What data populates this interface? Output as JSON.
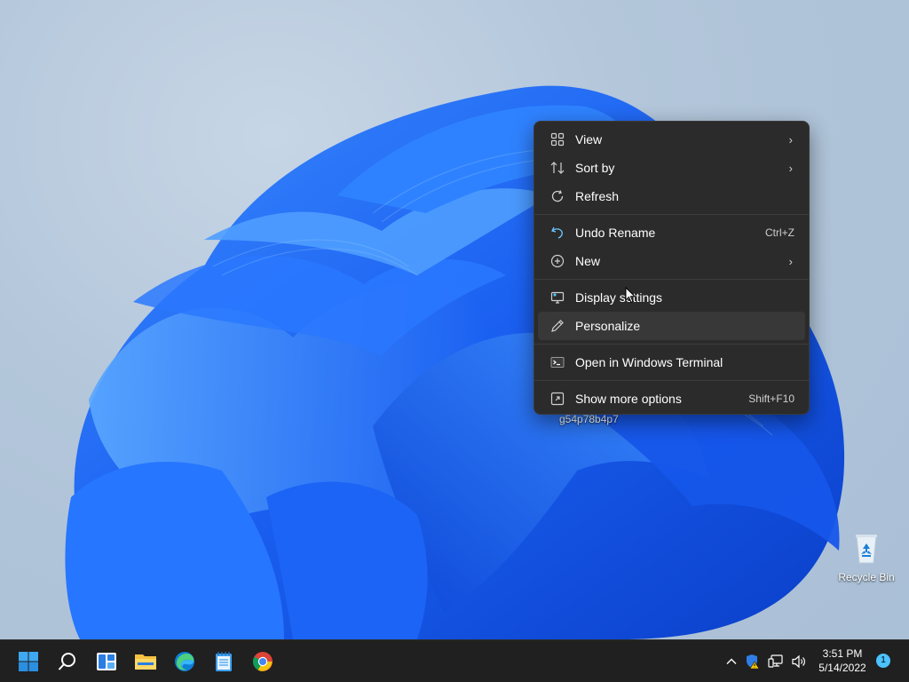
{
  "desktop": {
    "hovered_label": "g54p78b4p7",
    "recycle_bin_label": "Recycle Bin"
  },
  "context_menu": {
    "items": [
      {
        "label": "View",
        "icon": "grid-icon",
        "submenu": true
      },
      {
        "label": "Sort by",
        "icon": "sort-icon",
        "submenu": true
      },
      {
        "label": "Refresh",
        "icon": "refresh-icon"
      },
      {
        "label": "Undo Rename",
        "icon": "undo-icon",
        "shortcut": "Ctrl+Z"
      },
      {
        "label": "New",
        "icon": "plus-circle-icon",
        "submenu": true
      },
      {
        "label": "Display settings",
        "icon": "display-icon"
      },
      {
        "label": "Personalize",
        "icon": "pen-icon",
        "highlighted": true
      },
      {
        "label": "Open in Windows Terminal",
        "icon": "terminal-icon"
      },
      {
        "label": "Show more options",
        "icon": "more-options-icon",
        "shortcut": "Shift+F10"
      }
    ],
    "submenu_arrow": "›"
  },
  "taskbar": {
    "pinned": [
      "start-icon",
      "search-icon",
      "widgets-icon",
      "file-explorer-icon",
      "edge-icon",
      "notepad-icon",
      "chrome-icon"
    ],
    "tray": {
      "chevron": "^",
      "icons": [
        "security-warning-icon",
        "network-icon",
        "volume-icon"
      ]
    },
    "clock": {
      "time": "3:51 PM",
      "date": "5/14/2022"
    },
    "notification_count": "1"
  },
  "colors": {
    "menu_bg": "#2b2b2b",
    "taskbar_bg": "#202020",
    "accent": "#4cc2ff",
    "wallpaper_blue": "#1a5ff0"
  }
}
